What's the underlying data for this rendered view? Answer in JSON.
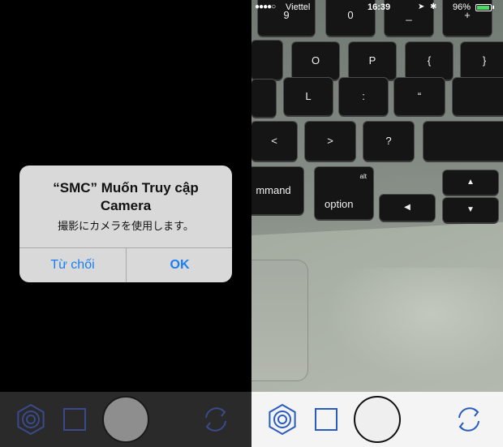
{
  "left_screen": {
    "alert": {
      "title": "“SMC” Muốn Truy cập Camera",
      "message": "撮影にカメラを使用します。",
      "deny_label": "Từ chối",
      "ok_label": "OK"
    },
    "toolbar": {
      "background": "#2a2a2a",
      "icon_color": "#3a4a8a",
      "shutter_color": "#8e8e8e"
    }
  },
  "right_screen": {
    "status_bar": {
      "signal": "●●●●○",
      "carrier": "Viettel",
      "time": "16:39",
      "location": "➤",
      "bluetooth": "✱",
      "battery_text": "96%",
      "battery_color": "#4cd964"
    },
    "keyboard": {
      "keys": {
        "nine": "9",
        "zero": "0",
        "minus": "_",
        "plus": "+",
        "o": "O",
        "p": "P",
        "brace_open": "{",
        "brace_close": "}",
        "l": "L",
        "colon": ":",
        "quote": "“",
        "lt": "<",
        "gt": ">",
        "question": "?",
        "command": "mmand",
        "option": "option",
        "alt": "alt",
        "left": "◀",
        "up": "▲",
        "down": "▼"
      }
    },
    "toolbar": {
      "background": "#f4f4f4",
      "icon_color": "#2a5bbf",
      "shutter_color": "#efefef"
    }
  }
}
